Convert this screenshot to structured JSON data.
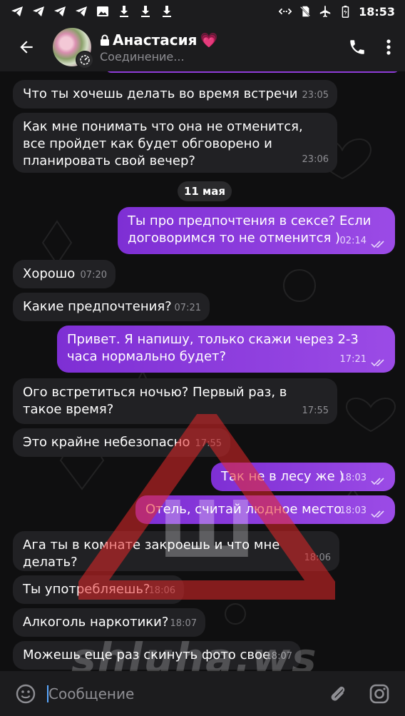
{
  "status_bar": {
    "time": "18:53",
    "left_icons": [
      "telegram-icon",
      "telegram-icon",
      "telegram-icon",
      "telegram-icon",
      "image-icon",
      "download-icon",
      "download-icon",
      "download-icon"
    ],
    "right_icons": [
      "data-saver-icon",
      "no-sim-icon",
      "airplane-icon",
      "battery-icon"
    ]
  },
  "header": {
    "contact_name": "Анастасия",
    "status": "Соединение...",
    "name_emoji": "💗",
    "accent_color": "#8e3bd8"
  },
  "date_separator": "11 мая",
  "messages": [
    {
      "dir": "in",
      "text": "Что ты хочешь делать во время встречи",
      "time": "23:05"
    },
    {
      "dir": "in",
      "text": "Как мне понимать что она не отменится, все пройдет как будет обговорено и планировать свой вечер?",
      "time": "23:06"
    },
    {
      "dir": "out",
      "text": "Ты про предпочтения в сексе? Если договоримся то не отменится )",
      "time": "02:14"
    },
    {
      "dir": "in",
      "text": "Хорошо",
      "time": "07:20"
    },
    {
      "dir": "in",
      "text": "Какие предпочтения?",
      "time": "07:21"
    },
    {
      "dir": "out",
      "text": "Привет. Я напишу, только скажи через 2-3 часа нормально будет?",
      "time": "17:21"
    },
    {
      "dir": "in",
      "text": "Ого встретиться ночью? Первый раз, в такое время?",
      "time": "17:55"
    },
    {
      "dir": "in",
      "text": "Это крайне небезопасно",
      "time": "17:55"
    },
    {
      "dir": "out",
      "text": "Так не в лесу же )",
      "time": "18:03"
    },
    {
      "dir": "out",
      "text": "Отель, считай людное место",
      "time": "18:03"
    },
    {
      "dir": "in",
      "text": "Ага ты в комнате закроешь и что мне делать?",
      "time": "18:06"
    },
    {
      "dir": "in",
      "text": "Ты употребляешь?",
      "time": "18:06"
    },
    {
      "dir": "in",
      "text": "Алкоголь наркотики?",
      "time": "18:07"
    },
    {
      "dir": "in",
      "text": "Можешь еще раз скинуть фото свое",
      "time": "18:07"
    }
  ],
  "watermark": {
    "text": "shluha.ws",
    "letter": "Ш",
    "color": "#e02424"
  },
  "input": {
    "placeholder": "Сообщение"
  }
}
